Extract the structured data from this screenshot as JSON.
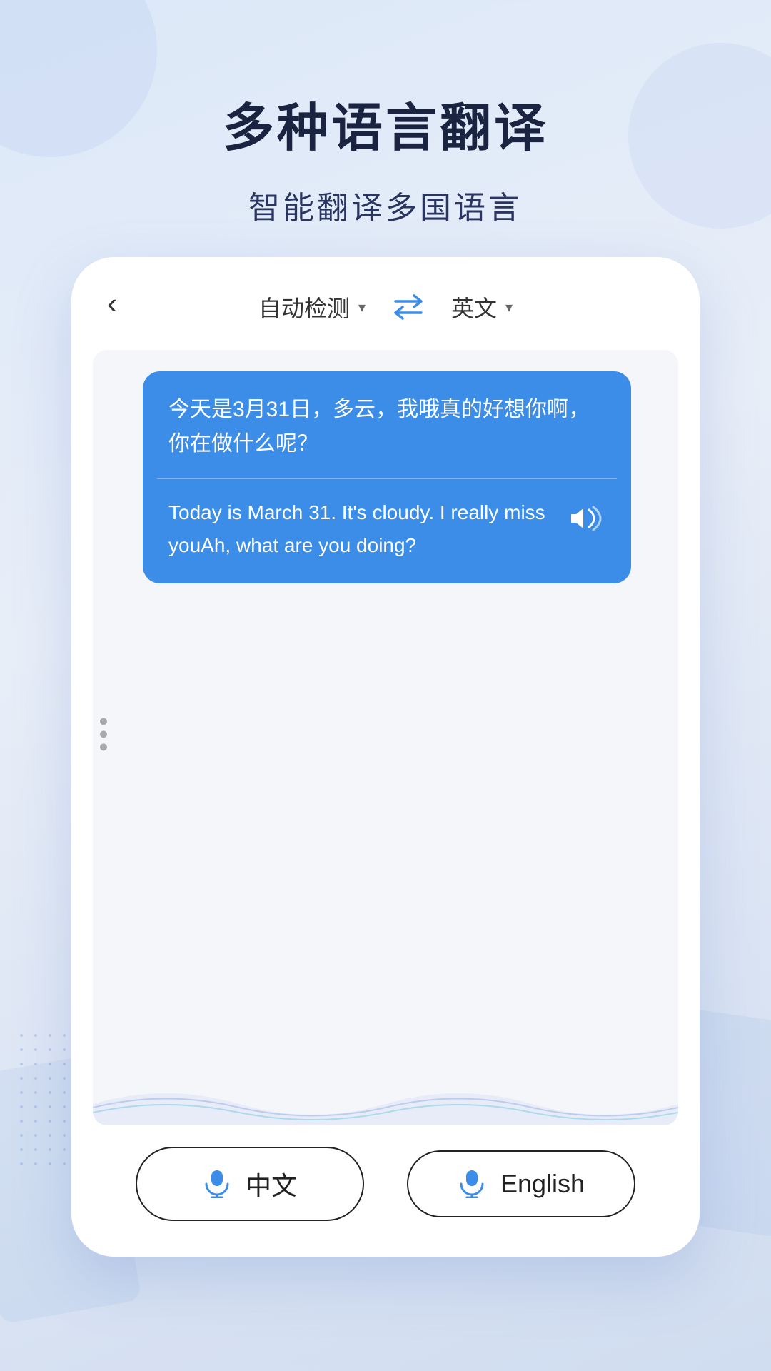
{
  "header": {
    "main_title": "多种语言翻译",
    "sub_title": "智能翻译多国语言"
  },
  "translator": {
    "back_label": "‹",
    "source_lang": "自动检测",
    "target_lang": "英文",
    "dropdown_arrow": "▾",
    "swap_label": "⇄"
  },
  "chat": {
    "original_text": "今天是3月31日，多云，我哦真的好想你啊，你在做什么呢？",
    "translated_text": "Today is March 31. It's cloudy. I really miss youAh, what are you doing?",
    "dots": [
      "•",
      "•",
      "•"
    ]
  },
  "buttons": {
    "chinese_label": "中文",
    "english_label": "English",
    "mic_symbol": "🎤"
  },
  "colors": {
    "bubble_bg": "#3b8de8",
    "accent": "#3b8de8"
  }
}
